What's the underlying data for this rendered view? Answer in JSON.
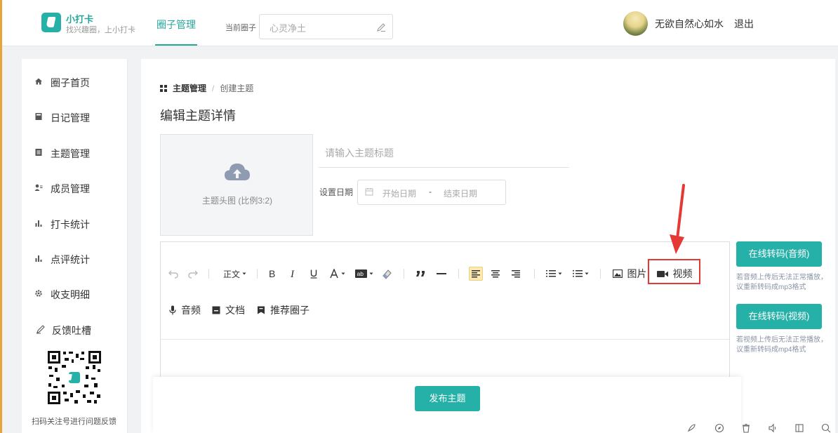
{
  "header": {
    "brand_name": "小打卡",
    "brand_slogan": "找兴趣圈，上小打卡",
    "nav_tab": "圈子管理",
    "circle_label": "当前圈子",
    "circle_value": "心灵净土",
    "username": "无欲自然心如水",
    "logout": "退出"
  },
  "sidebar": {
    "items": [
      {
        "label": "圈子首页",
        "icon": "home-icon"
      },
      {
        "label": "日记管理",
        "icon": "diary-icon"
      },
      {
        "label": "主题管理",
        "icon": "topic-icon"
      },
      {
        "label": "成员管理",
        "icon": "member-icon"
      },
      {
        "label": "打卡统计",
        "icon": "bar-chart-icon"
      },
      {
        "label": "点评统计",
        "icon": "bar-chart-icon"
      },
      {
        "label": "收支明细",
        "icon": "gear-icon"
      },
      {
        "label": "反馈吐槽",
        "icon": "pencil-icon"
      }
    ],
    "qr_caption": "扫码关注号进行问题反馈"
  },
  "main": {
    "breadcrumb_current": "主题管理",
    "breadcrumb_separator": "/",
    "breadcrumb_leaf": "创建主题",
    "page_title": "编辑主题详情",
    "upload_caption": "主题头图 (比例3:2)",
    "title_placeholder": "请输入主题标题",
    "date_label": "设置日期",
    "date_start_placeholder": "开始日期",
    "date_separator": "-",
    "date_end_placeholder": "结束日期"
  },
  "toolbar": {
    "paragraph": "正文",
    "image": "图片",
    "video": "视频",
    "audio": "音频",
    "document": "文档",
    "recommend_circle": "推荐圈子"
  },
  "side_actions": {
    "audio_button": "在线转码(音频)",
    "audio_hint": "若音频上传后无法正常播放，议重新转码成mp3格式",
    "video_button": "在线转码(视频)",
    "video_hint": "若视频上传后无法正常播放，议重新转码成mp4格式"
  },
  "publish_button": "发布主题",
  "colors": {
    "accent": "#26b1a8",
    "highlight": "#e53935"
  }
}
